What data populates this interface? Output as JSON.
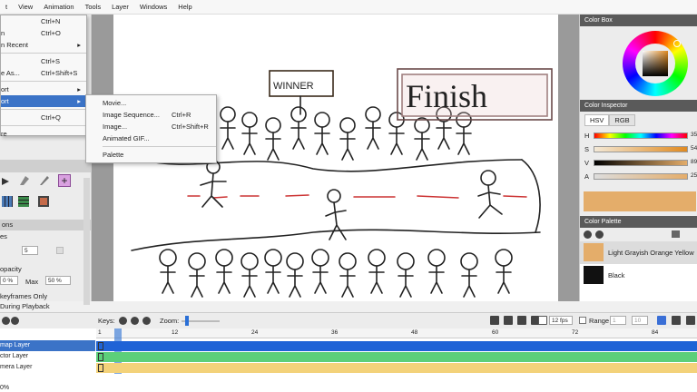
{
  "menubar": [
    "t",
    "View",
    "Animation",
    "Tools",
    "Layer",
    "Windows",
    "Help"
  ],
  "file_menu": [
    {
      "label": "",
      "shortcut": "Ctrl+N",
      "arrow": false
    },
    {
      "label": "n",
      "shortcut": "Ctrl+O",
      "arrow": false
    },
    {
      "label": "n Recent",
      "shortcut": "",
      "arrow": true
    },
    {
      "label": "",
      "shortcut": "Ctrl+S",
      "arrow": false
    },
    {
      "label": "e As...",
      "shortcut": "Ctrl+Shift+S",
      "arrow": false
    },
    {
      "label": "ort",
      "shortcut": "",
      "arrow": true
    },
    {
      "label": "ort",
      "shortcut": "",
      "arrow": true
    },
    {
      "label": "",
      "shortcut": "Ctrl+Q",
      "arrow": false
    },
    {
      "label": "re",
      "shortcut": "",
      "arrow": false
    }
  ],
  "export_menu": [
    {
      "label": "Movie...",
      "shortcut": ""
    },
    {
      "label": "Image Sequence...",
      "shortcut": "Ctrl+R"
    },
    {
      "label": "Image...",
      "shortcut": "Ctrl+Shift+R"
    },
    {
      "label": "Animated GIF...",
      "shortcut": ""
    },
    {
      "label": "Palette",
      "shortcut": ""
    }
  ],
  "left_panel": {
    "section_title": "ons",
    "row1_label": "es",
    "row1_value": "5",
    "opacity_label": "opacity",
    "opacity_value": "0 %",
    "max_label": "Max",
    "max_value": "50 %",
    "keyframes_label": "keyframes Only",
    "playback_label": "During Playback"
  },
  "right_panel": {
    "color_box_title": "Color Box",
    "inspector_title": "Color Inspector",
    "tabs": [
      "HSV",
      "RGB"
    ],
    "sliders": [
      {
        "label": "H",
        "value": "35"
      },
      {
        "label": "S",
        "value": "54"
      },
      {
        "label": "V",
        "value": "89"
      },
      {
        "label": "A",
        "value": "25"
      }
    ],
    "current_color": "#e4ad6a",
    "palette_title": "Color Palette",
    "palette": [
      {
        "name": "Light Grayish Orange Yellow",
        "color": "#e4ad6a"
      },
      {
        "name": "Black",
        "color": "#111111"
      }
    ]
  },
  "drawing": {
    "sign_winner": "WINNER",
    "sign_finish": "Finish"
  },
  "timeline": {
    "keys_label": "Keys:",
    "zoom_label": "Zoom:",
    "fps_value": "12 fps",
    "range_label": "Range",
    "range_from": "1",
    "range_to": "10",
    "ruler": [
      "1",
      "12",
      "24",
      "36",
      "48",
      "60",
      "72",
      "84"
    ],
    "layers": [
      {
        "name": "map Layer",
        "color": "#1f63d6"
      },
      {
        "name": "ctor Layer",
        "color": "#5ccf7a"
      },
      {
        "name": "mera Layer",
        "color": "#f3d27a"
      }
    ],
    "zoom_readout": "0%"
  }
}
